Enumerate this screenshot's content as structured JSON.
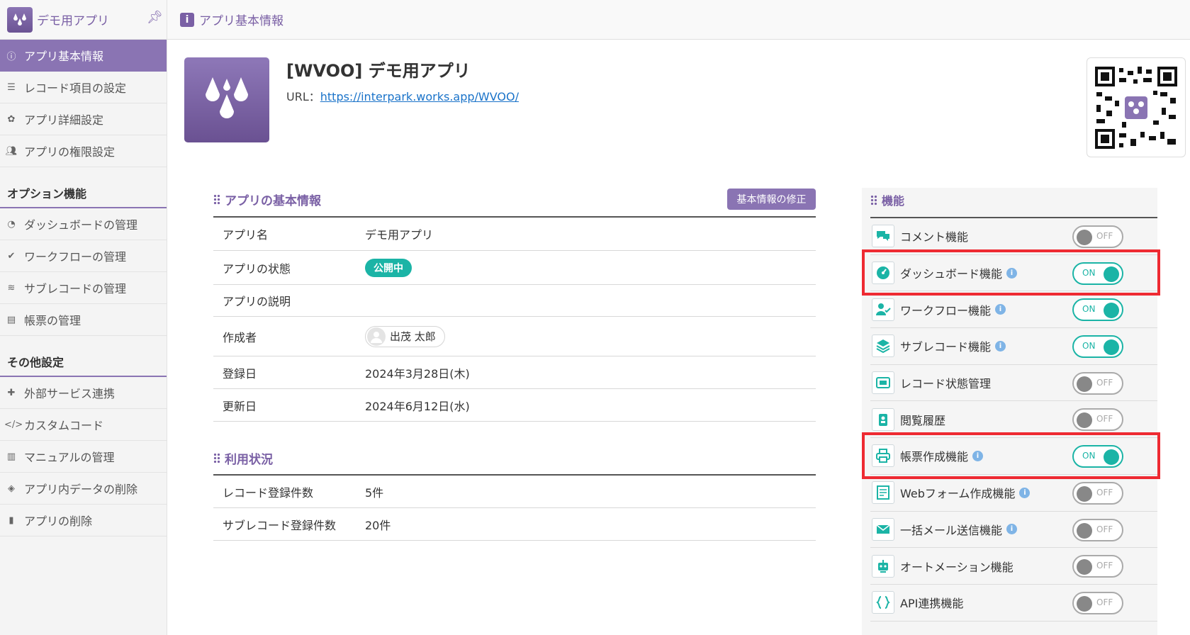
{
  "sidebar": {
    "brand_name": "デモ用アプリ",
    "items": [
      {
        "label": "アプリ基本情報",
        "icon": "info-icon",
        "active": true
      },
      {
        "label": "レコード項目の設定",
        "icon": "list-icon"
      },
      {
        "label": "アプリ詳細設定",
        "icon": "gear-icon"
      },
      {
        "label": "アプリの権限設定",
        "icon": "users-icon"
      }
    ],
    "section_options": "オプション機能",
    "option_items": [
      {
        "label": "ダッシュボードの管理",
        "icon": "dashboard-icon"
      },
      {
        "label": "ワークフローの管理",
        "icon": "workflow-icon"
      },
      {
        "label": "サブレコードの管理",
        "icon": "layers-icon"
      },
      {
        "label": "帳票の管理",
        "icon": "document-icon"
      }
    ],
    "section_other": "その他設定",
    "other_items": [
      {
        "label": "外部サービス連携",
        "icon": "puzzle-icon"
      },
      {
        "label": "カスタムコード",
        "icon": "code-icon"
      },
      {
        "label": "マニュアルの管理",
        "icon": "book-icon"
      },
      {
        "label": "アプリ内データの削除",
        "icon": "eraser-icon"
      },
      {
        "label": "アプリの削除",
        "icon": "trash-icon"
      }
    ]
  },
  "topbar": {
    "title": "アプリ基本情報",
    "icon": "info-icon"
  },
  "app": {
    "title": "[WVOO] デモ用アプリ",
    "url_label": "URL：",
    "url": "https://interpark.works.app/WVOO/"
  },
  "basic_info": {
    "heading": "アプリの基本情報",
    "edit_button": "基本情報の修正",
    "rows": {
      "name_key": "アプリ名",
      "name_val": "デモ用アプリ",
      "status_key": "アプリの状態",
      "status_val": "公開中",
      "desc_key": "アプリの説明",
      "creator_key": "作成者",
      "creator_val": "出茂 太郎",
      "registered_key": "登録日",
      "registered_val": "2024年3月28日(木)",
      "updated_key": "更新日",
      "updated_val": "2024年6月12日(水)"
    }
  },
  "usage": {
    "heading": "利用状況",
    "records_key": "レコード登録件数",
    "records_val": "5件",
    "subrecords_key": "サブレコード登録件数",
    "subrecords_val": "20件"
  },
  "features": {
    "heading": "機能",
    "on_text": "ON",
    "off_text": "OFF",
    "items": [
      {
        "label": "コメント機能",
        "state": "off",
        "info": false,
        "icon": "comment-icon"
      },
      {
        "label": "ダッシュボード機能",
        "state": "on",
        "info": true,
        "icon": "dashboard-icon",
        "highlighted": true
      },
      {
        "label": "ワークフロー機能",
        "state": "on",
        "info": true,
        "icon": "workflow-icon"
      },
      {
        "label": "サブレコード機能",
        "state": "on",
        "info": true,
        "icon": "layers-icon"
      },
      {
        "label": "レコード状態管理",
        "state": "off",
        "info": false,
        "icon": "status-icon"
      },
      {
        "label": "閲覧履歴",
        "state": "off",
        "info": false,
        "icon": "badge-icon"
      },
      {
        "label": "帳票作成機能",
        "state": "on",
        "info": true,
        "icon": "printer-icon",
        "highlighted": true
      },
      {
        "label": "Webフォーム作成機能",
        "state": "off",
        "info": true,
        "icon": "form-icon"
      },
      {
        "label": "一括メール送信機能",
        "state": "off",
        "info": true,
        "icon": "mail-icon"
      },
      {
        "label": "オートメーション機能",
        "state": "off",
        "info": false,
        "icon": "robot-icon"
      },
      {
        "label": "API連携機能",
        "state": "off",
        "info": false,
        "icon": "braces-icon"
      }
    ]
  },
  "colors": {
    "accent": "#8a74b3",
    "teal": "#1bb4a6",
    "highlight": "#ee2a32"
  }
}
